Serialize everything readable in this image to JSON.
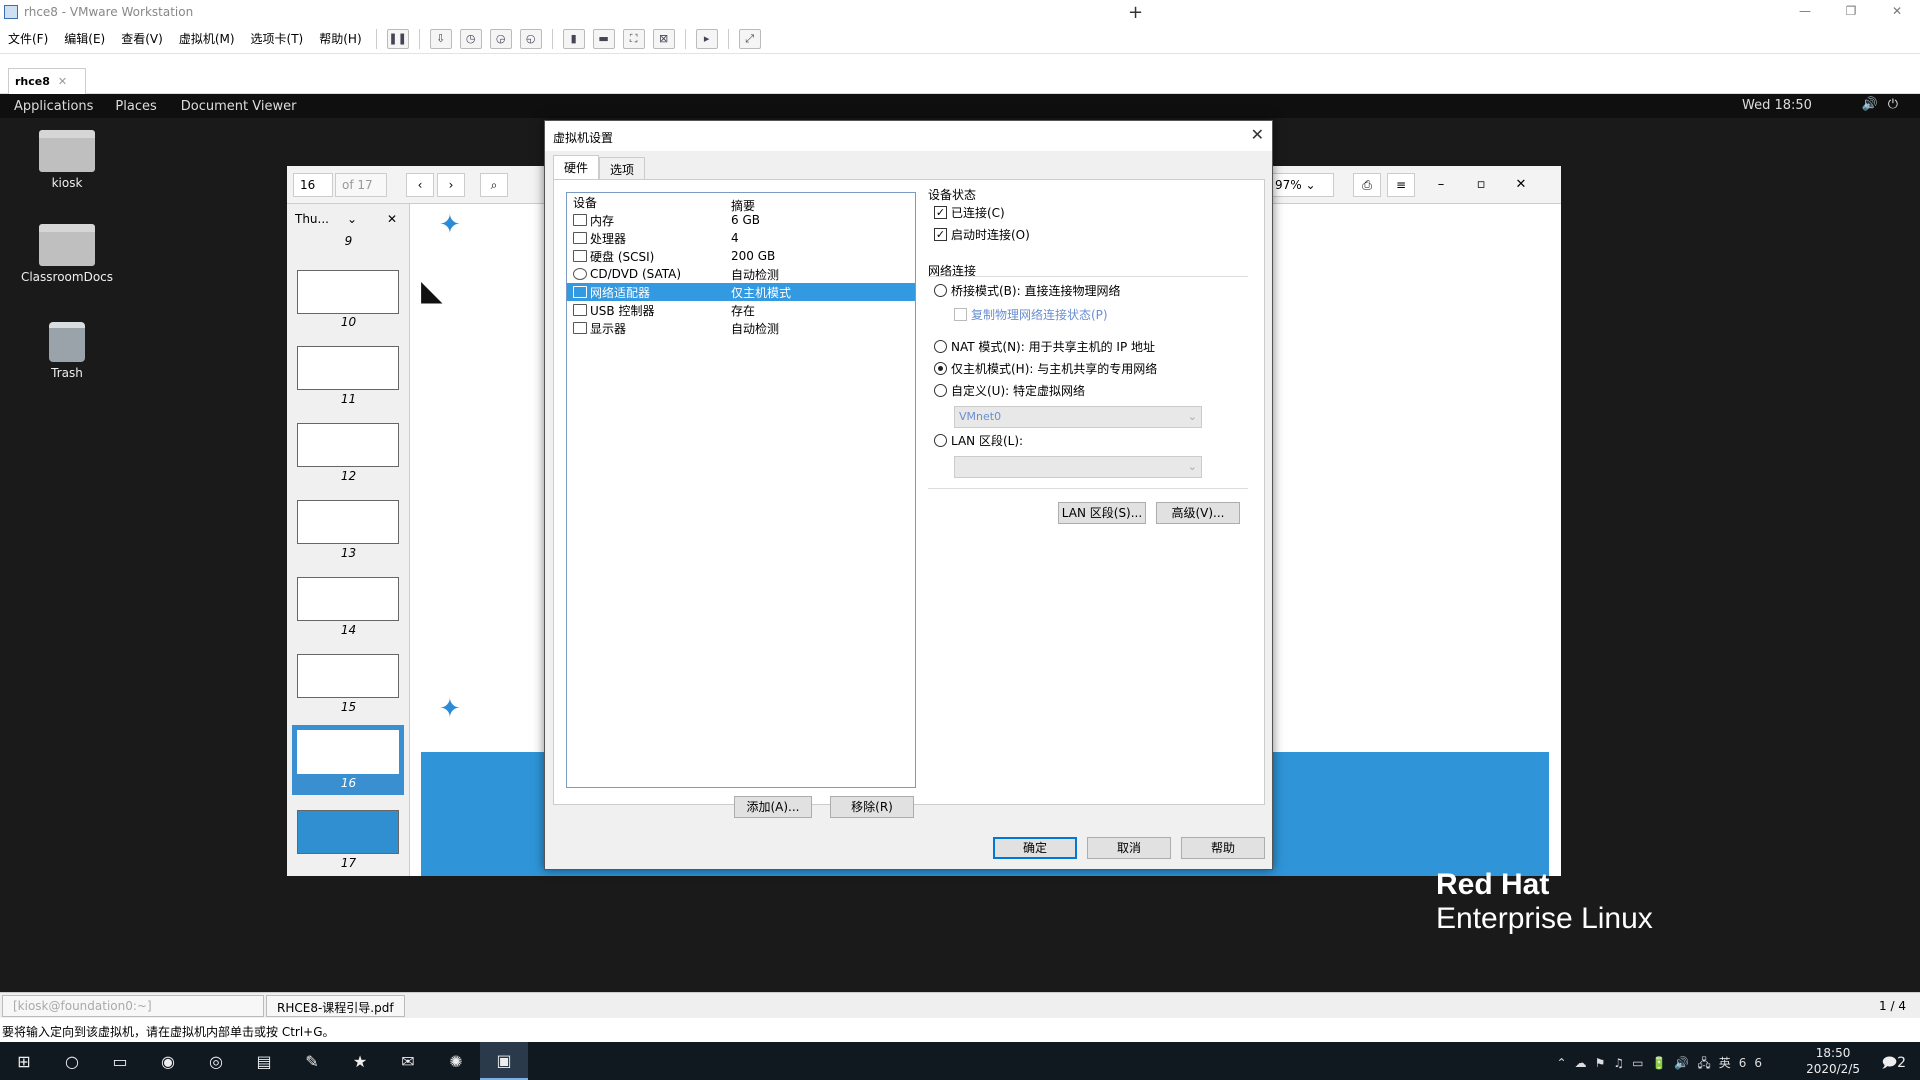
{
  "vmware": {
    "title": "rhce8 - VMware Workstation",
    "menu": [
      "文件(F)",
      "编辑(E)",
      "查看(V)",
      "虚拟机(M)",
      "选项卡(T)",
      "帮助(H)"
    ],
    "tab_label": "rhce8",
    "status_text": "要将输入定向到该虚拟机，请在虚拟机内部单击或按 Ctrl+G。"
  },
  "gnome": {
    "applications": "Applications",
    "places": "Places",
    "app_name": "Document Viewer",
    "clock": "Wed 18:50"
  },
  "desktop_icons": [
    {
      "label": "kiosk"
    },
    {
      "label": "ClassroomDocs"
    },
    {
      "label": "Trash"
    }
  ],
  "docviewer": {
    "page_current": "16",
    "page_total": "of 17",
    "zoom": "97%",
    "thumb_header": "Thu...",
    "thumbnails": [
      "9",
      "10",
      "11",
      "12",
      "13",
      "14",
      "15",
      "16",
      "17"
    ],
    "selected_page": "16"
  },
  "redhat": {
    "line1": "Red Hat",
    "line2": "Enterprise Linux"
  },
  "guest_taskbar": {
    "task1": "[kiosk@foundation0:~]",
    "task2": "RHCE8-课程引导.pdf",
    "pager": "1 / 4"
  },
  "dialog": {
    "title": "虚拟机设置",
    "tabs": [
      "硬件",
      "选项"
    ],
    "list_header": {
      "device": "设备",
      "summary": "摘要"
    },
    "devices": [
      {
        "name": "内存",
        "summary": "6 GB",
        "icon": "memory-icon"
      },
      {
        "name": "处理器",
        "summary": "4",
        "icon": "cpu-icon"
      },
      {
        "name": "硬盘 (SCSI)",
        "summary": "200 GB",
        "icon": "disk-icon"
      },
      {
        "name": "CD/DVD (SATA)",
        "summary": "自动检测",
        "icon": "cdrom-icon"
      },
      {
        "name": "网络适配器",
        "summary": "仅主机模式",
        "icon": "network-icon",
        "selected": true
      },
      {
        "name": "USB 控制器",
        "summary": "存在",
        "icon": "usb-icon"
      },
      {
        "name": "显示器",
        "summary": "自动检测",
        "icon": "monitor-icon"
      }
    ],
    "add_button": "添加(A)...",
    "remove_button": "移除(R)",
    "device_status": {
      "title": "设备状态",
      "connected": "已连接(C)",
      "connect_on_power": "启动时连接(O)",
      "connected_checked": true,
      "connect_on_power_checked": true
    },
    "network": {
      "title": "网络连接",
      "bridged": "桥接模式(B): 直接连接物理网络",
      "replicate": "复制物理网络连接状态(P)",
      "nat": "NAT 模式(N): 用于共享主机的 IP 地址",
      "host_only": "仅主机模式(H): 与主机共享的专用网络",
      "custom": "自定义(U): 特定虚拟网络",
      "custom_value": "VMnet0",
      "lan": "LAN 区段(L):",
      "lan_value": "",
      "selected": "host_only"
    },
    "lan_segments_button": "LAN 区段(S)...",
    "advanced_button": "高级(V)...",
    "ok_button": "确定",
    "cancel_button": "取消",
    "help_button": "帮助"
  },
  "windows": {
    "time": "18:50",
    "date": "2020/2/5",
    "ime": "英",
    "notif_count": "2",
    "battery": "66"
  }
}
